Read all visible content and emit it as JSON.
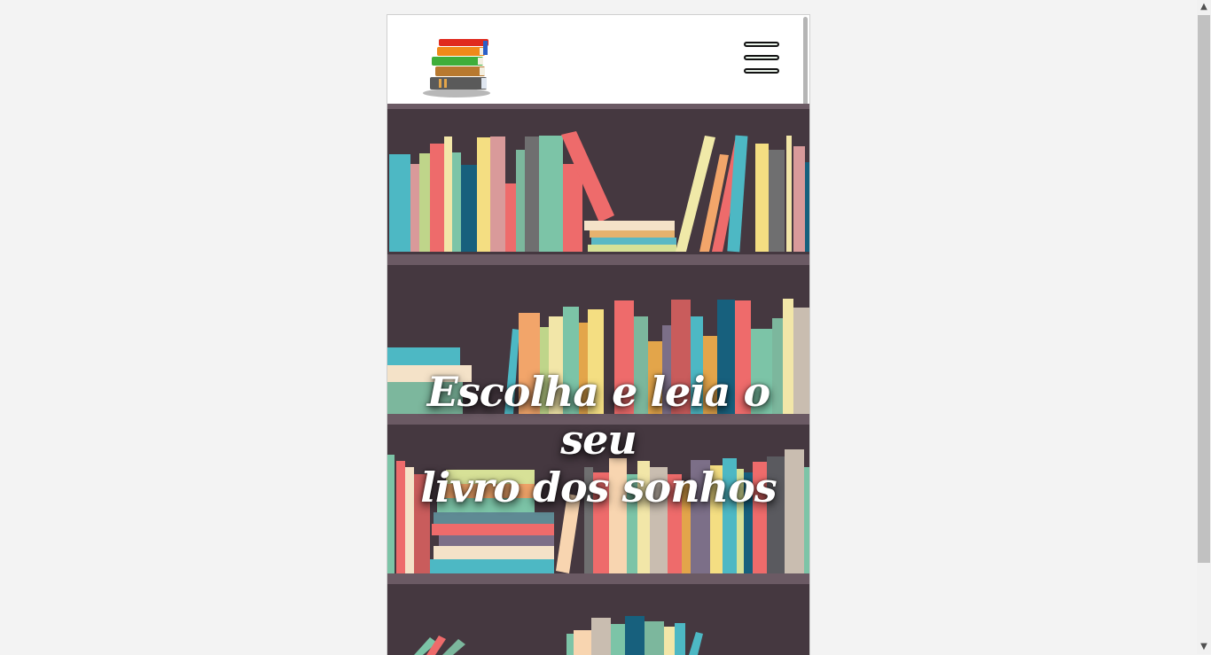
{
  "header": {
    "logo_icon": "stacked-books-icon",
    "menu_icon": "hamburger-icon"
  },
  "hero": {
    "title_line1": "Escolha e leia o seu",
    "title_line2": "livro dos sonhos",
    "background": "bookshelf-illustration"
  },
  "colors": {
    "page_background": "#f3f3f3",
    "hero_background": "#453840",
    "shelf": "#6b5a64",
    "title_text": "#ffffff"
  },
  "scrollbar": {
    "up_icon": "chevron-up-icon",
    "down_icon": "chevron-down-icon"
  }
}
